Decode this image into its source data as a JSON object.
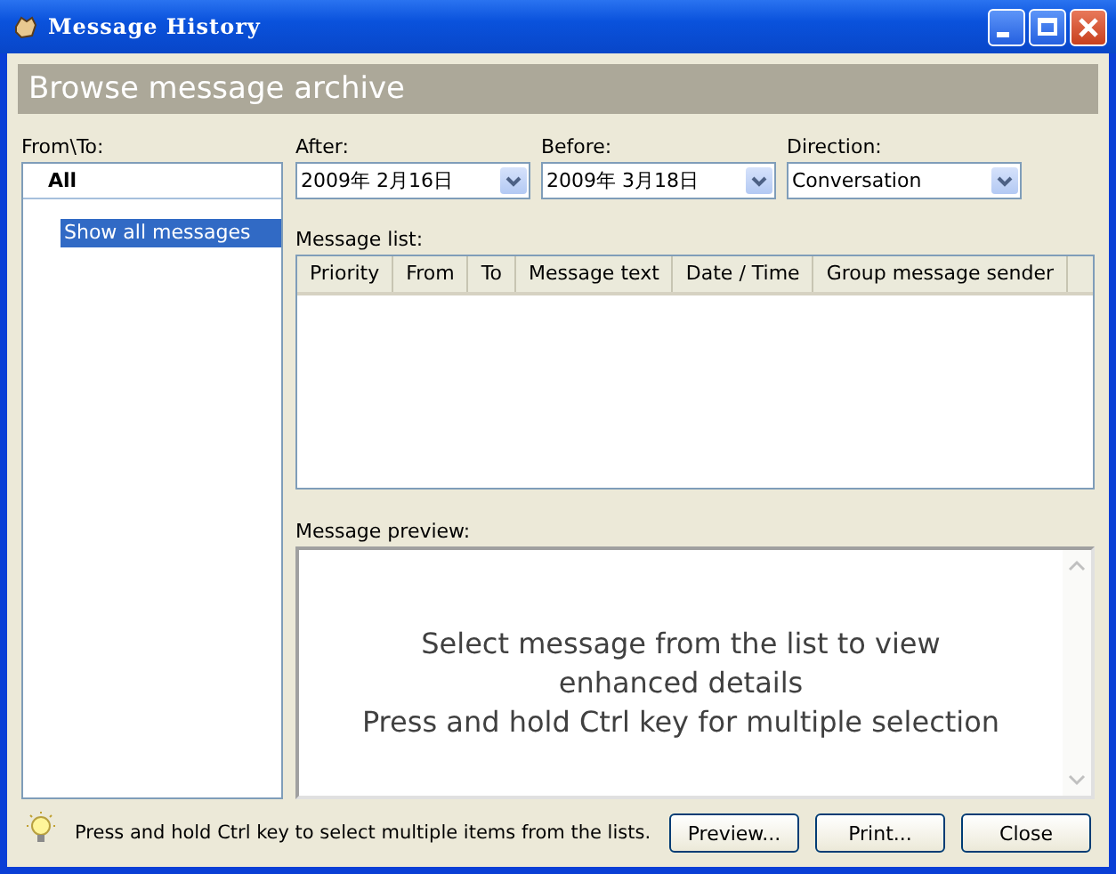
{
  "window": {
    "title": "Message History"
  },
  "header": {
    "title": "Browse message archive"
  },
  "contacts": {
    "label": "From\\To:",
    "items": [
      {
        "label": "All",
        "kind": "group",
        "selected": false
      },
      {
        "label": "Show all messages",
        "kind": "item",
        "selected": true
      }
    ]
  },
  "filters": [
    {
      "label": "After:",
      "value": "2009年 2月16日"
    },
    {
      "label": "Before:",
      "value": "2009年 3月18日"
    },
    {
      "label": "Direction:",
      "value": "Conversation"
    }
  ],
  "message_list": {
    "label": "Message list:",
    "columns": [
      "Priority",
      "From",
      "To",
      "Message text",
      "Date / Time",
      "Group message sender"
    ]
  },
  "preview": {
    "label": "Message preview:",
    "lines": [
      "Select message from the list to view",
      "enhanced details",
      "Press and hold Ctrl key for multiple selection"
    ]
  },
  "hint": "Press and hold Ctrl key to select multiple items from the lists.",
  "buttons": [
    "Preview...",
    "Print...",
    "Close"
  ]
}
